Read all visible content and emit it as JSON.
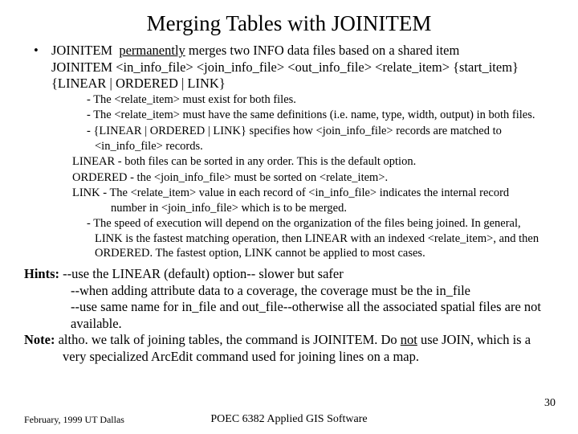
{
  "title": "Merging Tables with JOINITEM",
  "lvl1": {
    "line1a": "JOINITEM",
    "line1b": "permanently",
    "line1c": " merges two INFO data files based on a shared item",
    "line2": "JOINITEM <in_info_file> <join_info_file> <out_info_file> <relate_item> {start_item} {LINEAR | ORDERED | LINK}"
  },
  "lvl2": {
    "n1": "- The <relate_item> must exist for both files.",
    "n2": "- The <relate_item> must have the same definitions (i.e. name, type, width, output) in both files.",
    "n3": "- {LINEAR | ORDERED | LINK} specifies how <join_info_file> records are matched to <in_info_file> records.",
    "opt1": "LINEAR - both files can be sorted in any order.  This is the default option.",
    "opt2": "ORDERED - the <join_info_file> must be sorted on <relate_item>.",
    "opt3": "LINK - The <relate_item> value in each record of <in_info_file> indicates the internal record number in <join_info_file> which is to be merged.",
    "n4": "- The speed of execution will depend on the organization of the files being joined.  In general, LINK is the fastest matching operation, then LINEAR with an indexed <relate_item>, and then ORDERED. The fastest option, LINK cannot be applied to most cases."
  },
  "hints": {
    "label": "Hints:",
    "h1": "--use the LINEAR (default) option-- slower but safer",
    "h2": "--when adding attribute data to a coverage, the coverage must be the in_file",
    "h3": "--use same name for in_file and out_file--otherwise all the associated spatial files are not available.",
    "noteLabel": "Note:",
    "noteA": " altho. we talk of joining tables, the command is JOINITEM.  Do ",
    "noteNot": "not",
    "noteB": " use JOIN, which is a very specialized ArcEdit command used for joining lines on a map."
  },
  "footer": {
    "left": "February, 1999  UT Dallas",
    "center": "POEC 6382 Applied GIS Software",
    "page": "30"
  }
}
